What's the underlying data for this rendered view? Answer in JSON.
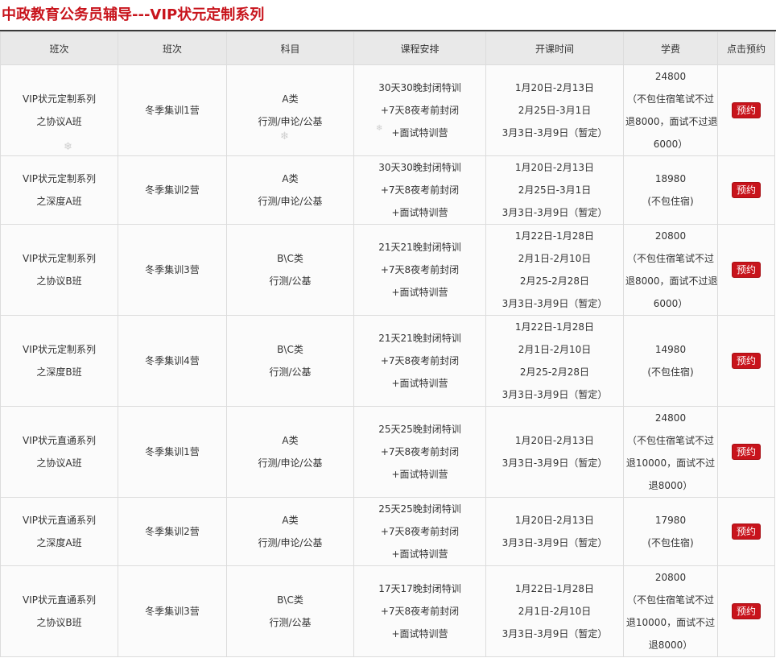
{
  "page": {
    "title": "中政教育公务员辅导---VIP状元定制系列"
  },
  "table": {
    "headers": [
      "班次",
      "班次",
      "科目",
      "课程安排",
      "开课时间",
      "学费",
      "点击预约"
    ],
    "book_label": "预约",
    "rows": [
      {
        "series": [
          "VIP状元定制系列",
          "之协议A班"
        ],
        "camp": "冬季集训1营",
        "subject": [
          "A类",
          "行测/申论/公基"
        ],
        "schedule": [
          "30天30晚封闭特训",
          "+7天8夜考前封闭",
          "+面试特训营"
        ],
        "dates": [
          "1月20日-2月13日",
          "2月25日-3月1日",
          "3月3日-3月9日（暂定）"
        ],
        "fee": [
          "24800",
          "（不包住宿笔试不过",
          "退8000，面试不过退",
          "6000）"
        ]
      },
      {
        "series": [
          "VIP状元定制系列",
          "之深度A班"
        ],
        "camp": "冬季集训2营",
        "subject": [
          "A类",
          "行测/申论/公基"
        ],
        "schedule": [
          "30天30晚封闭特训",
          "+7天8夜考前封闭",
          "+面试特训营"
        ],
        "dates": [
          "1月20日-2月13日",
          "2月25日-3月1日",
          "3月3日-3月9日（暂定）"
        ],
        "fee": [
          "18980",
          "(不包住宿)"
        ]
      },
      {
        "series": [
          "VIP状元定制系列",
          "之协议B班"
        ],
        "camp": "冬季集训3营",
        "subject": [
          "B\\C类",
          "行测/公基"
        ],
        "schedule": [
          "21天21晚封闭特训",
          "+7天8夜考前封闭",
          "+面试特训营"
        ],
        "dates": [
          "1月22日-1月28日",
          "2月1日-2月10日",
          "2月25-2月28日",
          "3月3日-3月9日（暂定）"
        ],
        "fee": [
          "20800",
          "（不包住宿笔试不过",
          "退8000，面试不过退",
          "6000）"
        ]
      },
      {
        "series": [
          "VIP状元定制系列",
          "之深度B班"
        ],
        "camp": "冬季集训4营",
        "subject": [
          "B\\C类",
          "行测/公基"
        ],
        "schedule": [
          "21天21晚封闭特训",
          "+7天8夜考前封闭",
          "+面试特训营"
        ],
        "dates": [
          "1月22日-1月28日",
          "2月1日-2月10日",
          "2月25-2月28日",
          "3月3日-3月9日（暂定）"
        ],
        "fee": [
          "14980",
          "(不包住宿)"
        ]
      },
      {
        "series": [
          "VIP状元直通系列",
          "之协议A班"
        ],
        "camp": "冬季集训1营",
        "subject": [
          "A类",
          "行测/申论/公基"
        ],
        "schedule": [
          "25天25晚封闭特训",
          "+7天8夜考前封闭",
          "+面试特训营"
        ],
        "dates": [
          "1月20日-2月13日",
          "3月3日-3月9日（暂定）"
        ],
        "fee": [
          "24800",
          "（不包住宿笔试不过",
          "退10000，面试不过",
          "退8000）"
        ]
      },
      {
        "series": [
          "VIP状元直通系列",
          "之深度A班"
        ],
        "camp": "冬季集训2营",
        "subject": [
          "A类",
          "行测/申论/公基"
        ],
        "schedule": [
          "25天25晚封闭特训",
          "+7天8夜考前封闭",
          "+面试特训营"
        ],
        "dates": [
          "1月20日-2月13日",
          "3月3日-3月9日（暂定）"
        ],
        "fee": [
          "17980",
          "(不包住宿)"
        ]
      },
      {
        "series": [
          "VIP状元直通系列",
          "之协议B班"
        ],
        "camp": "冬季集训3营",
        "subject": [
          "B\\C类",
          "行测/公基"
        ],
        "schedule": [
          "17天17晚封闭特训",
          "+7天8夜考前封闭",
          "+面试特训营"
        ],
        "dates": [
          "1月22日-1月28日",
          "2月1日-2月10日",
          "3月3日-3月9日（暂定）"
        ],
        "fee": [
          "20800",
          "（不包住宿笔试不过",
          "退10000，面试不过",
          "退8000）"
        ]
      }
    ]
  },
  "colors": {
    "accent": "#c8141c",
    "header_bg": "#e9e9e9",
    "cell_bg": "#fbfbfb",
    "border": "#dcdcdc"
  }
}
